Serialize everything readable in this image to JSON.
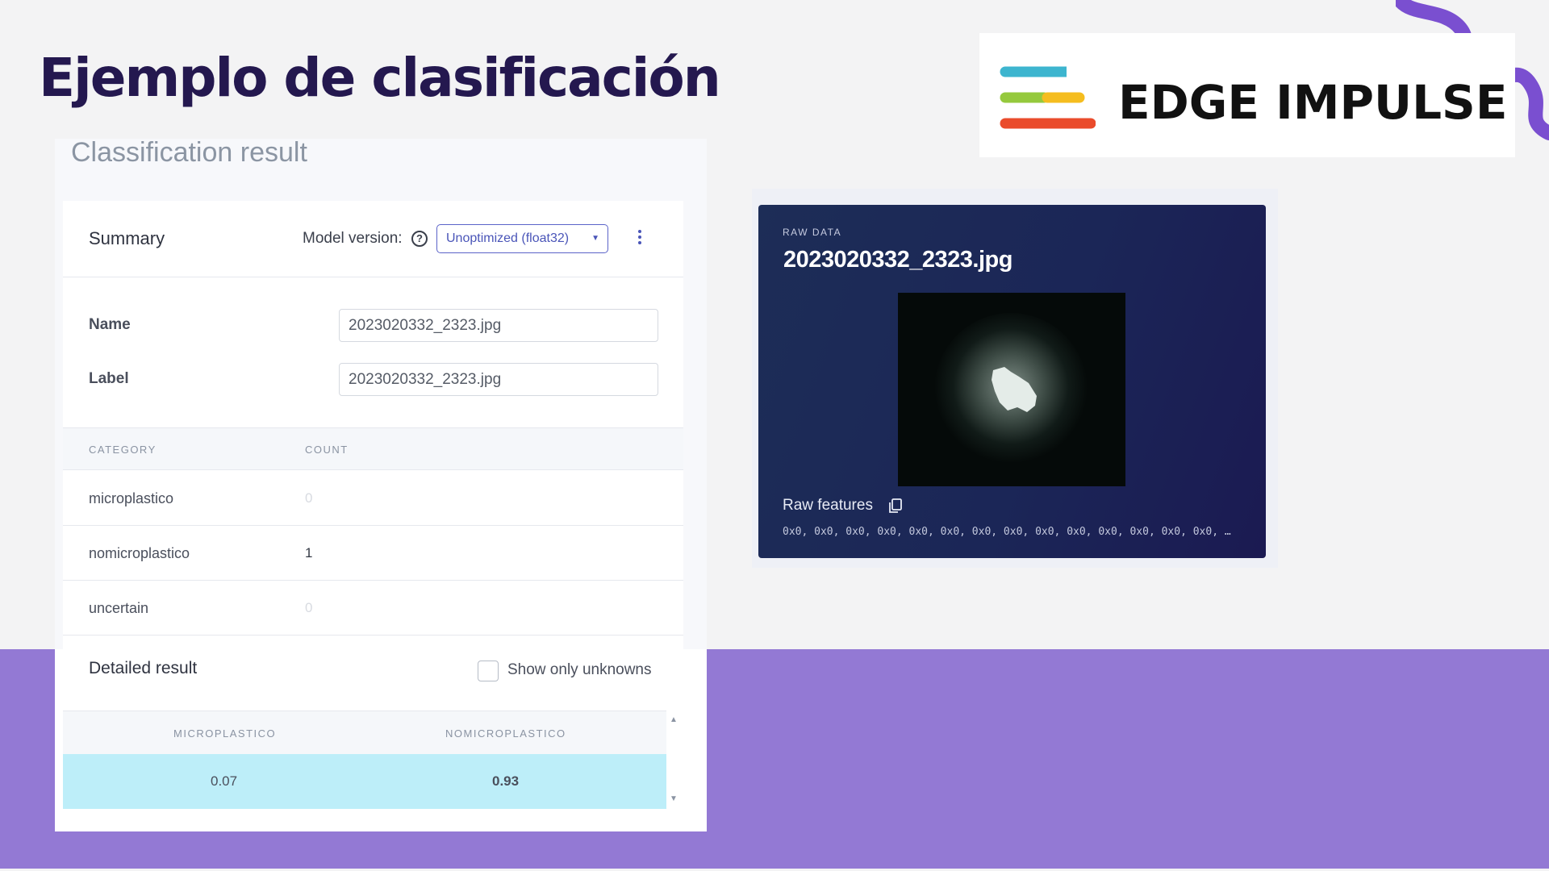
{
  "slide": {
    "title": "Ejemplo de clasificación",
    "logo_text": "EDGE IMPULSE",
    "colors": {
      "title": "#24184f",
      "purple_band": "#9379d4",
      "logo_bar_cyan": "#3db5cf",
      "logo_bar_green": "#95c93d",
      "logo_bar_yellow": "#f5bd1f",
      "logo_bar_red": "#ea4b2b"
    }
  },
  "panel": {
    "heading": "Classification result",
    "summary": {
      "title": "Summary",
      "model_version_label": "Model version:",
      "help_icon": "question-circle-icon",
      "model_version_value": "Unoptimized (float32)",
      "menu_icon": "vertical-dots-icon"
    },
    "fields": {
      "name_label": "Name",
      "name_value": "2023020332_2323.jpg",
      "label_label": "Label",
      "label_value": "2023020332_2323.jpg"
    },
    "table": {
      "headers": [
        "CATEGORY",
        "COUNT"
      ],
      "rows": [
        {
          "category": "microplastico",
          "count": "0"
        },
        {
          "category": "nomicroplastico",
          "count": "1"
        },
        {
          "category": "uncertain",
          "count": "0"
        }
      ]
    },
    "detailed": {
      "title": "Detailed result",
      "checkbox_label": "Show only unknowns",
      "checkbox_checked": false,
      "headers": [
        "MICROPLASTICO",
        "NOMICROPLASTICO"
      ],
      "values": [
        "0.07",
        "0.93"
      ]
    }
  },
  "raw": {
    "caption": "RAW DATA",
    "filename": "2023020332_2323.jpg",
    "features_label": "Raw features",
    "copy_icon": "copy-icon",
    "features_values": "0x0, 0x0, 0x0, 0x0, 0x0, 0x0, 0x0, 0x0, 0x0, 0x0, 0x0, 0x0, 0x0, 0x0, …"
  }
}
